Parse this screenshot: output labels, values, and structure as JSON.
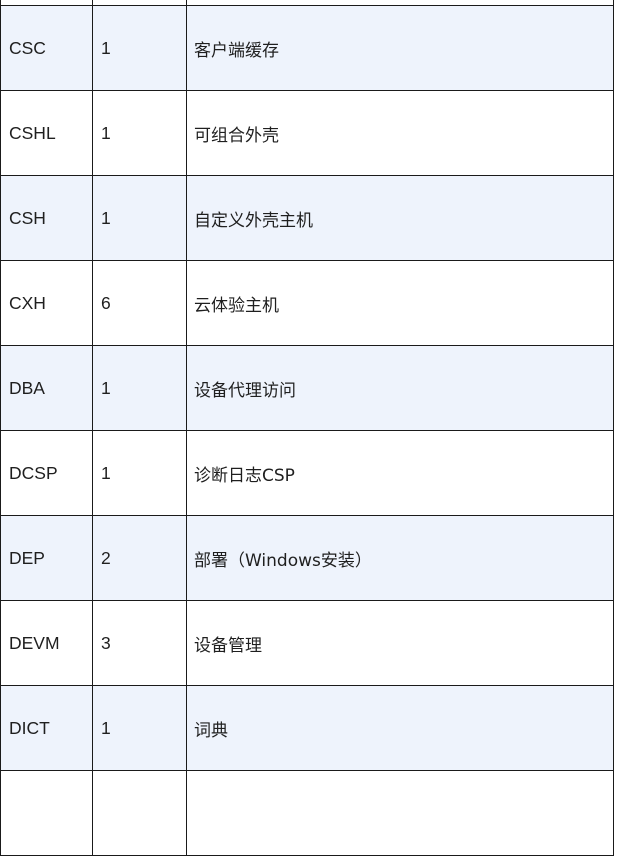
{
  "table": {
    "rows": [
      {
        "code": "",
        "count": "",
        "desc": ""
      },
      {
        "code": "CSC",
        "count": "1",
        "desc": "客户端缓存"
      },
      {
        "code": "CSHL",
        "count": "1",
        "desc": "可组合外壳"
      },
      {
        "code": "CSH",
        "count": "1",
        "desc": "自定义外壳主机"
      },
      {
        "code": "CXH",
        "count": "6",
        "desc": "云体验主机"
      },
      {
        "code": "DBA",
        "count": "1",
        "desc": "设备代理访问"
      },
      {
        "code": "DCSP",
        "count": "1",
        "desc": "诊断日志CSP"
      },
      {
        "code": "DEP",
        "count": "2",
        "desc": "部署（Windows安装）"
      },
      {
        "code": "DEVM",
        "count": "3",
        "desc": "设备管理"
      },
      {
        "code": "DICT",
        "count": "1",
        "desc": "词典"
      },
      {
        "code": "",
        "count": "",
        "desc": ""
      }
    ]
  }
}
